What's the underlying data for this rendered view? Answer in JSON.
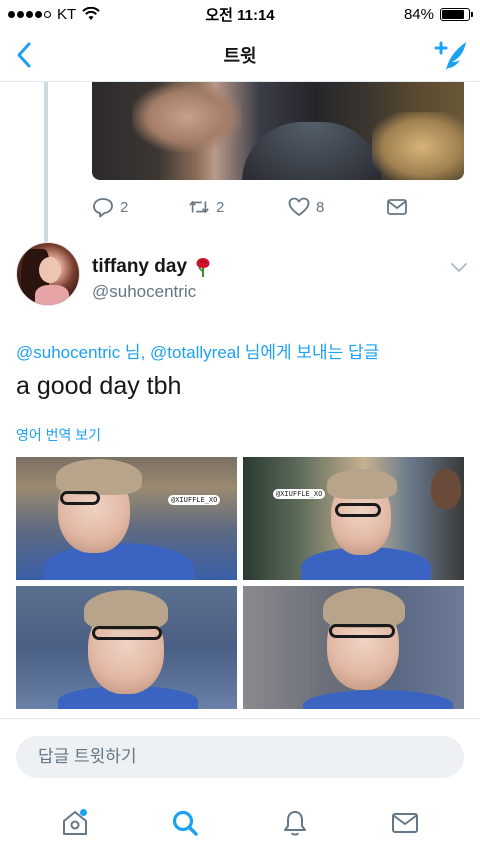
{
  "status_bar": {
    "carrier": "KT",
    "time": "오전 11:14",
    "battery": "84%",
    "battery_level": 0.84
  },
  "nav": {
    "title": "트윗",
    "back_icon": "chevron-left-icon",
    "compose_icon": "compose-tweet-icon"
  },
  "previous_tweet": {
    "reply_count": "2",
    "retweet_count": "2",
    "like_count": "8"
  },
  "tweet": {
    "display_name": "tiffany day",
    "emoji_icon": "rose-icon",
    "username": "@suhocentric",
    "reply_to": {
      "mention_1": "@suhocentric",
      "suffix_1": " 님, ",
      "mention_2": "@totallyreal",
      "suffix_2": " 님에게 보내는 답글"
    },
    "text": "a good day tbh",
    "translate_label": "영어 번역 보기",
    "media": [
      {
        "watermark": "@XIUFFLE_XO"
      },
      {
        "watermark": "@XIUFFLE_XO"
      },
      {
        "watermark": ""
      },
      {
        "watermark": ""
      }
    ]
  },
  "reply": {
    "placeholder": "답글 트윗하기"
  },
  "tabs": [
    {
      "icon": "home-icon",
      "active": false,
      "has_dot": true
    },
    {
      "icon": "search-icon",
      "active": true,
      "has_dot": false
    },
    {
      "icon": "notifications-icon",
      "active": false,
      "has_dot": false
    },
    {
      "icon": "messages-icon",
      "active": false,
      "has_dot": false
    }
  ],
  "colors": {
    "accent": "#1da1f2",
    "secondary_text": "#657786",
    "primary_text": "#14171a",
    "divider": "#e1e8ed"
  }
}
